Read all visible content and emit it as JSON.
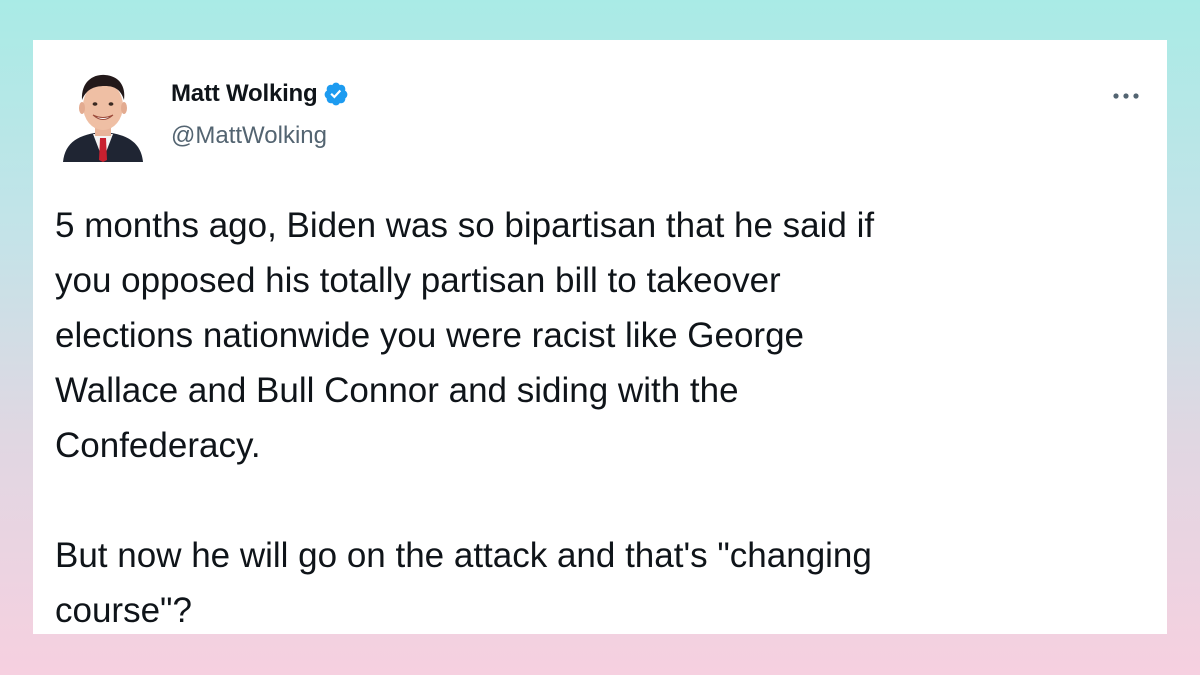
{
  "author": {
    "display_name": "Matt Wolking",
    "handle": "@MattWolking",
    "verified": true,
    "avatar_icon": "profile-photo"
  },
  "menu": {
    "more_icon": "more-options-icon"
  },
  "tweet": {
    "paragraphs": [
      "5 months ago, Biden was so bipartisan that he said if\nyou opposed his totally partisan bill to takeover\nelections nationwide you were racist like George\nWallace and Bull Connor and siding with the\nConfederacy.",
      "But now he will go on the attack and that's \"changing\ncourse\"?"
    ]
  },
  "colors": {
    "background_top": "#a9ebe6",
    "background_bottom": "#f6d0e0",
    "card": "#ffffff",
    "text": "#0f1419",
    "secondary_text": "#536471",
    "verified_blue": "#1d9bf0"
  }
}
